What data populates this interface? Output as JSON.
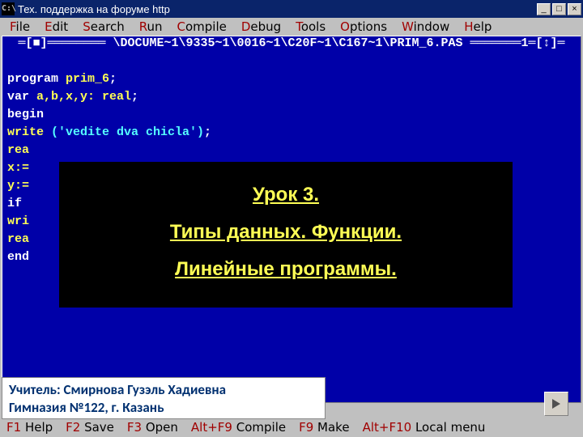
{
  "window": {
    "title": "Тех. поддержка на форуме http",
    "sys_icon_label": "C:\\"
  },
  "menu": [
    {
      "hot": "F",
      "rest": "ile"
    },
    {
      "hot": "E",
      "rest": "dit"
    },
    {
      "hot": "S",
      "rest": "earch"
    },
    {
      "hot": "R",
      "rest": "un"
    },
    {
      "hot": "C",
      "rest": "ompile"
    },
    {
      "hot": "D",
      "rest": "ebug"
    },
    {
      "hot": "T",
      "rest": "ools"
    },
    {
      "hot": "O",
      "rest": "ptions"
    },
    {
      "hot": "W",
      "rest": "indow"
    },
    {
      "hot": "H",
      "rest": "elp"
    }
  ],
  "editor": {
    "title_line": "═[■]════════ \\DOCUME~1\\9335~1\\0016~1\\C20F~1\\C167~1\\PRIM_6.PAS ═══════1═[↕]═",
    "code_lines": {
      "l1_kw": "program",
      "l1_id": " prim_6",
      "l1_p": ";",
      "l2_kw": "var",
      "l2_id": " a,b,x,y: real",
      "l2_p": ";",
      "l3_kw": "begin",
      "l4_id": "write ",
      "l4_str": "('vedite dva chicla')",
      "l4_p": ";",
      "l5_id": "rea",
      "l6_id": "x:=",
      "l7_id": "y:=",
      "l8_kw": "if",
      "l9_id": "wri",
      "l10_id": "rea",
      "l11_kw": "end"
    }
  },
  "overlay": {
    "line1": "Урок 3.",
    "line2": "Типы данных. Функции.",
    "line3": "Линейные программы."
  },
  "teacher": {
    "line1": "Учитель: Смирнова Гузэль Хадиевна",
    "line2": "Гимназия №122, г. Казань"
  },
  "status": [
    {
      "key": "F1",
      "label": " Help"
    },
    {
      "key": "F2",
      "label": " Save"
    },
    {
      "key": "F3",
      "label": " Open"
    },
    {
      "key": "Alt+F9",
      "label": " Compile"
    },
    {
      "key": "F9",
      "label": " Make"
    },
    {
      "key": "Alt+F10",
      "label": " Local menu"
    }
  ]
}
